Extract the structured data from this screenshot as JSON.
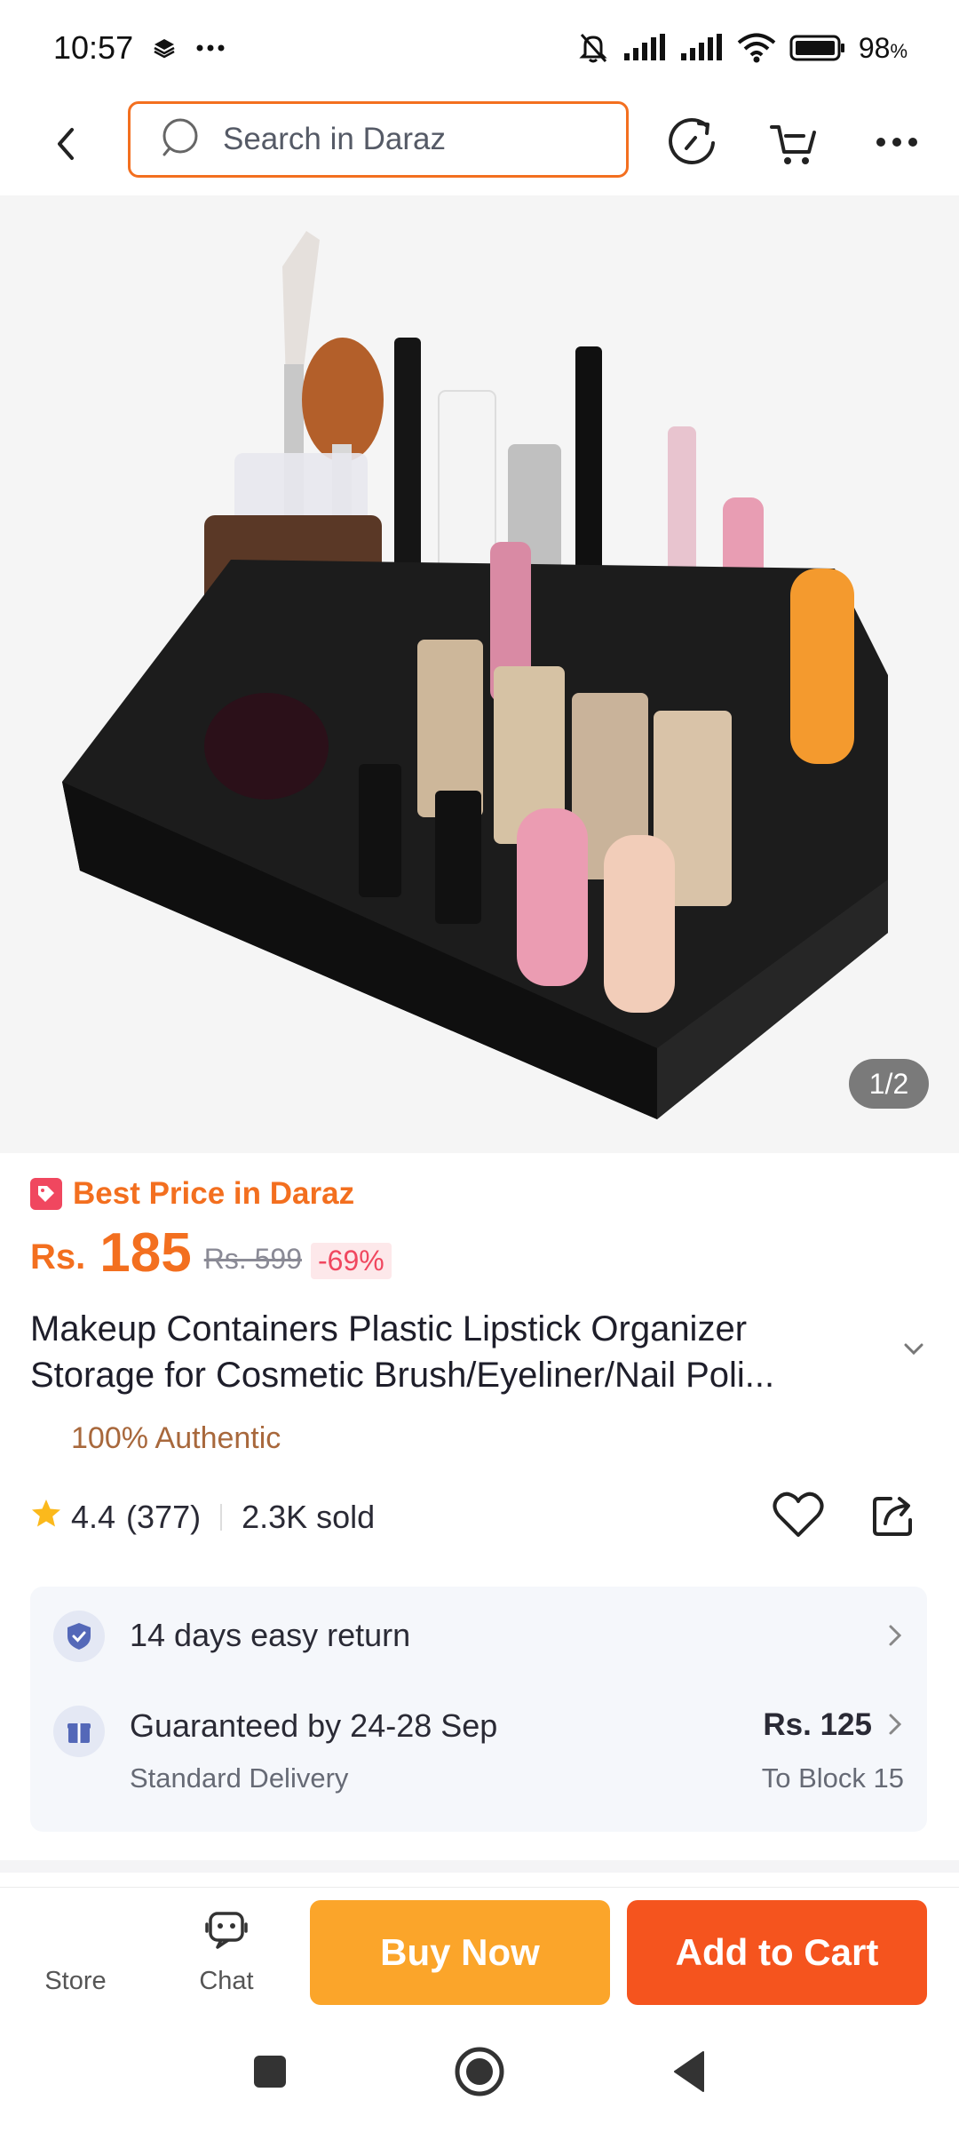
{
  "status_bar": {
    "time": "10:57",
    "battery": "98",
    "battery_unit": "%"
  },
  "header": {
    "search_placeholder": "Search in Daraz",
    "icons": [
      "back-arrow-icon",
      "search-icon",
      "history-refresh-icon",
      "cart-icon",
      "more-icon"
    ]
  },
  "gallery": {
    "counter": "1/2"
  },
  "product": {
    "promo_label": "Best Price in Daraz",
    "currency": "Rs.",
    "price": "185",
    "original_price": "Rs. 599",
    "discount": "-69%",
    "title_line1": "Makeup Containers Plastic Lipstick Organizer",
    "title_line2": "Storage for Cosmetic Brush/Eyeliner/Nail Poli...",
    "authentic": "100% Authentic",
    "rating": "4.4",
    "rating_count": "(377)",
    "sold": "2.3K sold"
  },
  "services": {
    "return_label": "14 days easy return",
    "delivery_label": "Guaranteed by 24-28 Sep",
    "delivery_type": "Standard Delivery",
    "delivery_fee": "Rs. 125",
    "delivery_location": "To Block 15"
  },
  "bottom_bar": {
    "store_label": "Store",
    "chat_label": "Chat",
    "buy_now_label": "Buy Now",
    "add_to_cart_label": "Add to Cart"
  },
  "colors": {
    "brand_orange": "#f36f1f",
    "buy_now": "#fba52a",
    "add_to_cart": "#f5541e",
    "discount_red": "#f0475f"
  }
}
